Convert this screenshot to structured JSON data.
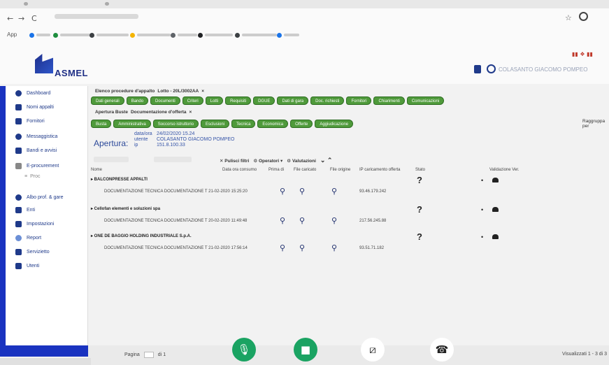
{
  "browser": {
    "back": "←",
    "forward": "→",
    "reload": "C",
    "star": "☆",
    "apps_label": "App",
    "bookmark_colors": [
      "#1a73e8",
      "#1e8e3e",
      "#3c4043",
      "#f4b400",
      "#5f6368",
      "#202124",
      "#3c4043",
      "#1a73e8"
    ]
  },
  "header": {
    "logo": "ASMEL",
    "user_name": "COLASANTO GIACOMO POMPEO",
    "flags": "▮▮ ❖ ▮▮"
  },
  "sidebar": {
    "items": [
      {
        "label": "Dashboard",
        "icon": "home-icon"
      },
      {
        "label": "Nomi appalti",
        "icon": "balance-icon"
      },
      {
        "label": "Fornitori",
        "icon": "truck-icon"
      },
      {
        "label": "Messaggistica",
        "icon": "envelope-icon"
      },
      {
        "label": "Bandi e avvisi",
        "icon": "megaphone-icon"
      },
      {
        "label": "E-procurement",
        "icon": "cart-icon"
      },
      {
        "label": "Albo prof. & gare",
        "icon": "book-icon"
      },
      {
        "label": "Enti",
        "icon": "people-icon"
      },
      {
        "label": "Impostazioni",
        "icon": "gear-icon"
      },
      {
        "label": "Report",
        "icon": "chart-icon"
      },
      {
        "label": "Servizietto",
        "icon": "doc-icon"
      },
      {
        "label": "Utenti",
        "icon": "lock-icon"
      }
    ],
    "sub_item": "Proc"
  },
  "content": {
    "tabs_row1": [
      "Elenco procedure d'appalto",
      "Lotto - 20L/3002AA",
      "×"
    ],
    "pills_row1": [
      "Dati generali",
      "Bando",
      "Documenti",
      "Criteri",
      "Lotti",
      "Requisiti",
      "DGUE",
      "Dati di gara",
      "Doc. richiesti",
      "Fornitori",
      "Chiarimenti",
      "Comunicazioni"
    ],
    "tabs_row2": [
      "Apertura Buste",
      "Documentazione d'offerta",
      "×"
    ],
    "pills_row2": [
      "Busta",
      "Amministrativa",
      "Soccorso istruttorio",
      "Esclusioni",
      "Tecnica",
      "Economica",
      "Offerte",
      "Aggiudicazione"
    ],
    "apertura": "Apertura:",
    "meta": [
      {
        "k": "data/ora",
        "v": "24/02/2020 15.24"
      },
      {
        "k": "utente",
        "v": "COLASANTO GIACOMO POMPEO"
      },
      {
        "k": "ip",
        "v": "151.8.100.33"
      }
    ],
    "sort_label": "Raggruppa per",
    "filters": [
      "Pulisci filtri",
      "Operatori",
      "Valutazioni"
    ],
    "columns": [
      "Nome",
      "Data ora consumo",
      "Prima di",
      "File caricato",
      "File origine",
      "IP caricamento offerta",
      "Stato",
      "Validazione Ver."
    ],
    "groups": [
      {
        "title": "▸ BALCONPRESSE APPALTI",
        "row": "DOCUMENTAZIONE TECNICA   DOCUMENTAZIONE T 21-02-2020 15:25:20",
        "ip": "93.46.179.242"
      },
      {
        "title": "▸ Cellofan elementi e soluzioni spa",
        "row": "DOCUMENTAZIONE TECNICA   DOCUMENTAZIONE T 20-02-2020 11:49:48",
        "ip": "217.56.245.88"
      },
      {
        "title": "▸ ONE DE BAGGIO HOLDING INDUSTRIALE S.p.A.",
        "row": "DOCUMENTAZIONE TECNICA   DOCUMENTAZIONE T 21-02-2020 17:56:14",
        "ip": "93.51.71.182"
      }
    ],
    "status_symbol": "?",
    "bullet": "•",
    "search_glyph": "⚲"
  },
  "footer": {
    "page_label": "Pagina",
    "page_value": "1",
    "page_of": "di 1",
    "view_label": "Visualizzati 1 - 3 di 3",
    "call_colors": {
      "mic": "#1aa362",
      "cam": "#1aa362"
    }
  }
}
